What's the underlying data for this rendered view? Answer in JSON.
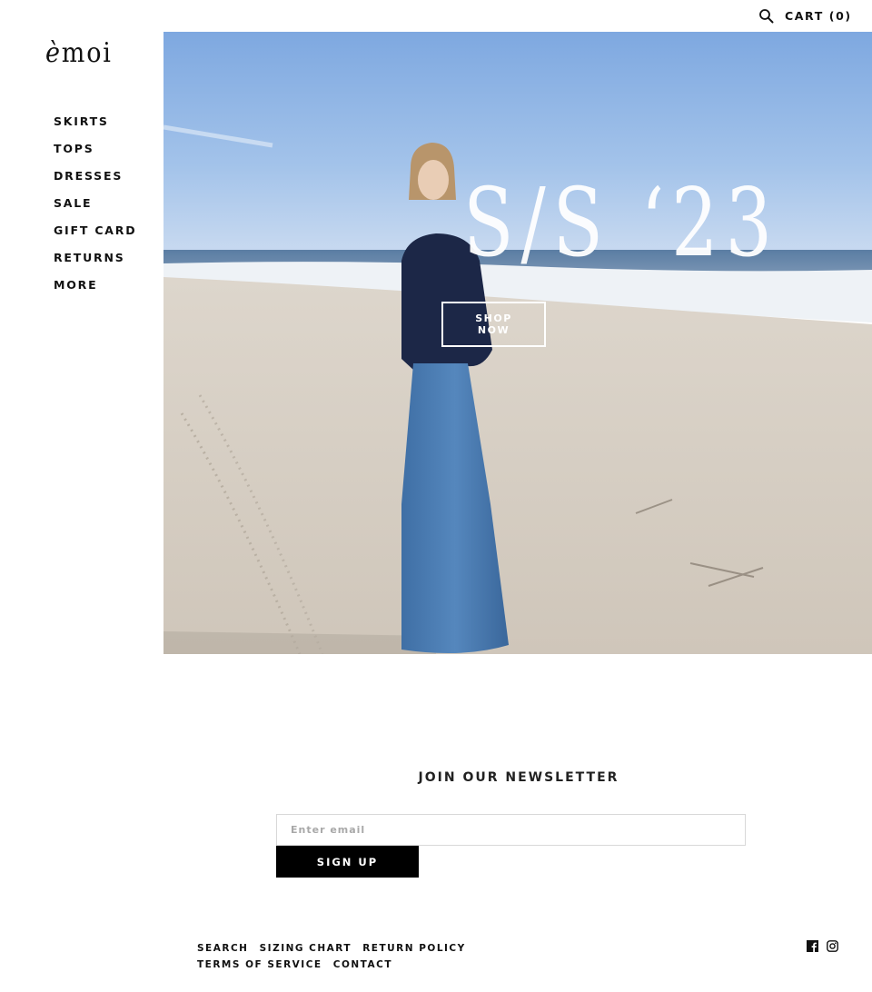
{
  "header": {
    "search_icon": "search-icon",
    "cart_label": "CART (0)"
  },
  "brand": {
    "logo_accent": "è",
    "logo_rest": "moi"
  },
  "sidebar": {
    "items": [
      {
        "label": "SKIRTS"
      },
      {
        "label": "TOPS"
      },
      {
        "label": "DRESSES"
      },
      {
        "label": "SALE"
      },
      {
        "label": "GIFT CARD"
      },
      {
        "label": "RETURNS"
      },
      {
        "label": "MORE"
      }
    ]
  },
  "hero": {
    "title": "S/S ‘23",
    "cta_line1": "SHOP",
    "cta_line2": "NOW",
    "image_description": "Woman in navy long-sleeve top and denim maxi skirt standing on a sandy beach with ocean waves and blue sky",
    "colors": {
      "sky": "#8fb6e6",
      "sand": "#d9d0c4",
      "top": "#1c2747",
      "skirt": "#4a7bb0"
    }
  },
  "newsletter": {
    "title": "JOIN OUR NEWSLETTER",
    "email_placeholder": "Enter email",
    "email_value": "",
    "submit_label": "SIGN UP"
  },
  "footer": {
    "links": [
      {
        "label": "SEARCH"
      },
      {
        "label": "SIZING CHART"
      },
      {
        "label": "RETURN POLICY"
      },
      {
        "label": "TERMS OF SERVICE"
      },
      {
        "label": "CONTACT"
      }
    ],
    "social": [
      {
        "icon": "facebook-icon"
      },
      {
        "icon": "instagram-icon"
      }
    ]
  }
}
